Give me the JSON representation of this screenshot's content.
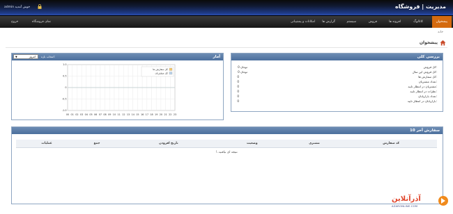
{
  "header": {
    "title": "مدیریت | فروشگاه",
    "welcome": "admin خوش آمدید"
  },
  "nav": {
    "items": [
      {
        "label": "پیشخوان",
        "active": true
      },
      {
        "label": "کاتالوگ"
      },
      {
        "label": "افزونه ها"
      },
      {
        "label": "فروش"
      },
      {
        "label": "سیستم"
      },
      {
        "label": "گزارش ها"
      },
      {
        "label": "امکانات و پشتیبانی"
      }
    ],
    "store_front": "نمای فروشگاه",
    "logout": "خروج"
  },
  "breadcrumb": "خانه",
  "page_title": "پیشخوان",
  "overview": {
    "title": "بررسی کلی",
    "rows": [
      {
        "label": "کل فروش:",
        "value": "0 تومان"
      },
      {
        "label": "کل فروش این سال:",
        "value": "0 تومان"
      },
      {
        "label": "کل سفارش ها:",
        "value": "0"
      },
      {
        "label": "تعداد مشتریان:",
        "value": "0"
      },
      {
        "label": "مشتریان در انتظار تایید:",
        "value": "0"
      },
      {
        "label": "نظرات در انتظار تایید:",
        "value": "0"
      },
      {
        "label": "تعداد بازاریابان:",
        "value": "0"
      },
      {
        "label": "بازاریابان در انتظار تایید:",
        "value": "0"
      }
    ]
  },
  "stats": {
    "title": "آمار",
    "range_label": "انتخاب بازه:",
    "range_value": "امروز",
    "chart_data": {
      "type": "line",
      "x": [
        "00",
        "01",
        "02",
        "03",
        "04",
        "05",
        "06",
        "07",
        "08",
        "09",
        "10",
        "11",
        "12",
        "13",
        "14",
        "15",
        "16",
        "17",
        "18",
        "19",
        "20",
        "21",
        "22",
        "23"
      ],
      "ylim": [
        -1.0,
        1.0
      ],
      "yticks": [
        "1.0",
        "0.5",
        "0",
        "-0.5",
        "-1.0"
      ],
      "series": [
        {
          "name": "کل سفارش ها",
          "color": "#f5c76a",
          "values": [
            0,
            0,
            0,
            0,
            0,
            0,
            0,
            0,
            0,
            0,
            0,
            0,
            0,
            0,
            0,
            0,
            0,
            0,
            0,
            0,
            0,
            0,
            0,
            0
          ]
        },
        {
          "name": "کل مشتریان",
          "color": "#b9d3ec",
          "values": [
            0,
            0,
            0,
            0,
            0,
            0,
            0,
            0,
            0,
            0,
            0,
            0,
            0,
            0,
            0,
            0,
            0,
            0,
            0,
            0,
            0,
            0,
            0,
            0
          ]
        }
      ],
      "grid": true,
      "legend": "top-right"
    }
  },
  "orders": {
    "title": "10 سفارش آخر",
    "columns": [
      "کد سفارش",
      "مشتری",
      "وضعیت",
      "تاریخ افزودن",
      "جمع",
      "عملیات"
    ],
    "empty": "نتیجه ای نیافتید..!"
  },
  "footer": {
    "logo_text": "آذرآنلاین",
    "logo_sub": "AZARONLINE.COM"
  },
  "colors": {
    "accent": "#d46a0f",
    "panel_head": "#5a7aa6"
  }
}
